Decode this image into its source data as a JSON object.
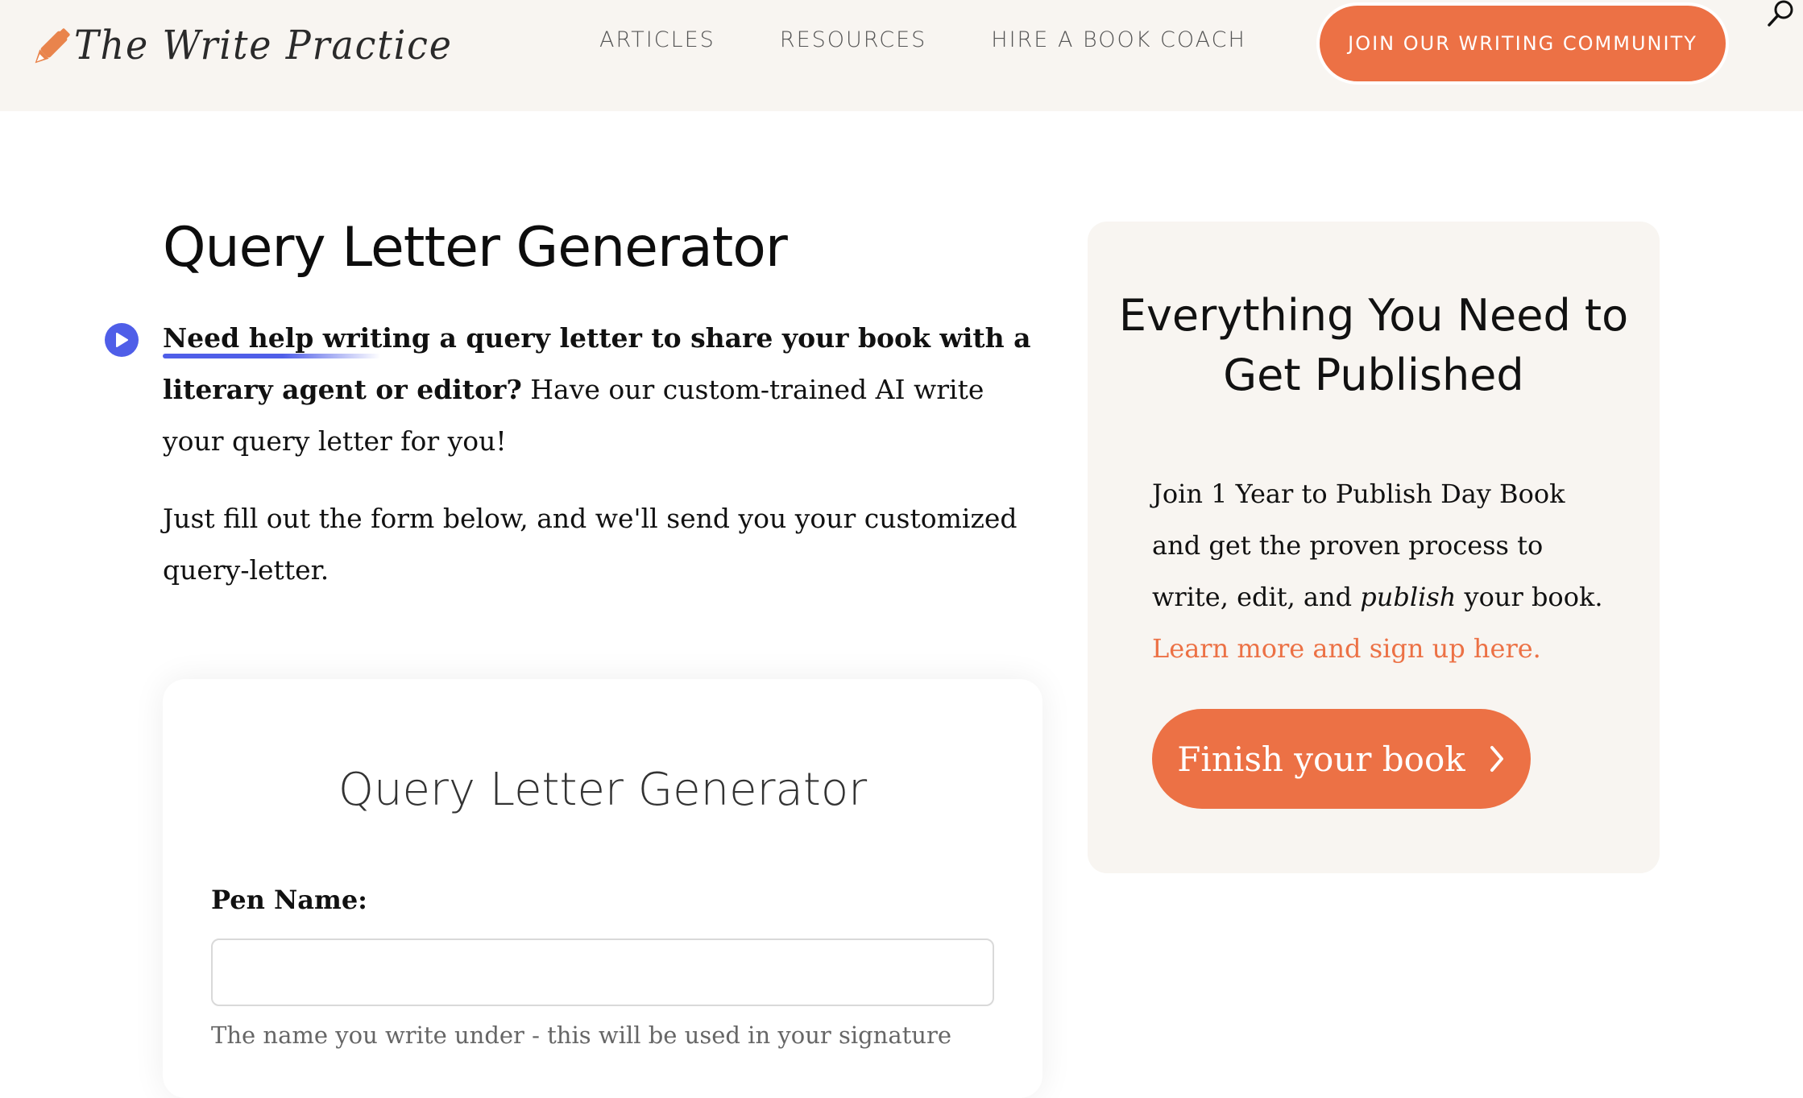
{
  "header": {
    "logo_text": "The Write Practice",
    "nav": [
      {
        "label": "ARTICLES"
      },
      {
        "label": "RESOURCES"
      },
      {
        "label": "HIRE A BOOK COACH"
      }
    ],
    "cta_label": "JOIN OUR WRITING COMMUNITY",
    "search_icon": "search-icon"
  },
  "main": {
    "title": "Query Letter Generator",
    "intro_bold_highlight": "Need help writing",
    "intro_bold_rest": " a query letter to share your book with a literary agent or editor?",
    "intro_rest": " Have our custom-trained AI write your query letter for you!",
    "intro2": "Just fill out the form below, and we'll send you your customized query-letter.",
    "play_icon": "play-icon"
  },
  "form": {
    "title": "Query Letter Generator",
    "fields": [
      {
        "label": "Pen Name:",
        "value": "",
        "placeholder": "",
        "help": "The name you write under - this will be used in your signature"
      }
    ]
  },
  "promo": {
    "title": "Everything You Need to Get Published",
    "text_1": "Join 1 Year to Publish Day Book and get the proven process to write, edit, and ",
    "text_em": "publish",
    "text_2": " your book.",
    "link_label": "Learn more and sign up here.",
    "button_label": "Finish your book",
    "button_icon": "chevron-right-icon"
  },
  "colors": {
    "accent": "#ec7145",
    "header_bg": "#f8f5f1",
    "highlight": "#4f5ee8"
  }
}
